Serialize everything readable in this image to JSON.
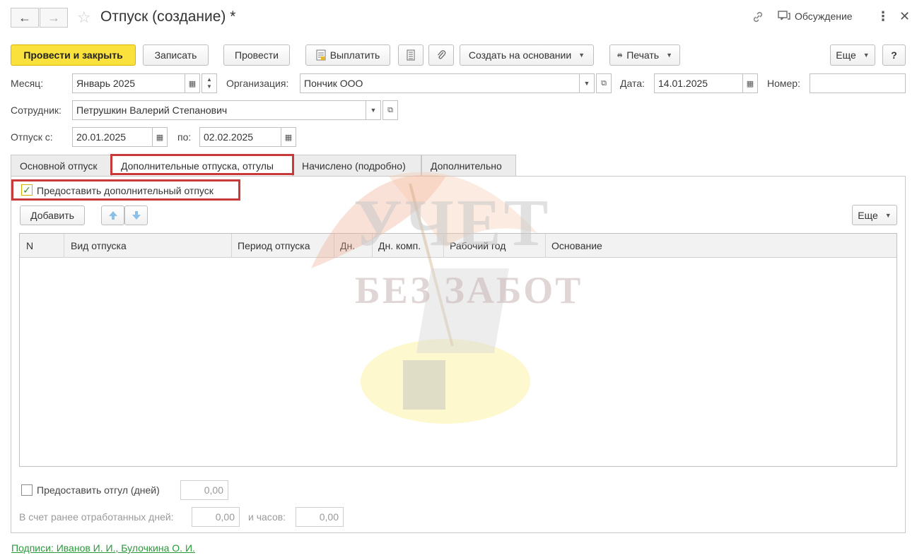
{
  "window": {
    "title": "Отпуск (создание) *",
    "discussion_label": "Обсуждение"
  },
  "toolbar": {
    "post_close": "Провести и закрыть",
    "save": "Записать",
    "post": "Провести",
    "pay": "Выплатить",
    "create_based": "Создать на основании",
    "print": "Печать",
    "more": "Еще",
    "help": "?"
  },
  "form": {
    "month_label": "Месяц:",
    "month_value": "Январь 2025",
    "org_label": "Организация:",
    "org_value": "Пончик ООО",
    "date_label": "Дата:",
    "date_value": "14.01.2025",
    "number_label": "Номер:",
    "number_value": "",
    "employee_label": "Сотрудник:",
    "employee_value": "Петрушкин Валерий Степанович",
    "vacation_from_label": "Отпуск с:",
    "vacation_from_value": "20.01.2025",
    "vacation_to_label": "по:",
    "vacation_to_value": "02.02.2025"
  },
  "tabs": [
    {
      "label": "Основной отпуск",
      "active": false
    },
    {
      "label": "Дополнительные отпуска, отгулы",
      "active": true
    },
    {
      "label": "Начислено (подробно)",
      "active": false
    },
    {
      "label": "Дополнительно",
      "active": false
    }
  ],
  "panel": {
    "grant_additional_label": "Предоставить дополнительный отпуск",
    "grant_additional_checked": true,
    "add_button": "Добавить",
    "more_button": "Еще",
    "columns": [
      "N",
      "Вид отпуска",
      "Период отпуска",
      "Дн.",
      "Дн. комп.",
      "Рабочий год",
      "Основание"
    ],
    "rows": [],
    "time_off_label": "Предоставить отгул (дней)",
    "time_off_checked": false,
    "time_off_days": "0,00",
    "worked_days_label": "В счет ранее отработанных дней:",
    "worked_days_value": "0,00",
    "hours_label": "и часов:",
    "hours_value": "0,00"
  },
  "footer": {
    "signatures_link": "Подписи: Иванов И. И., Булочкина О. И."
  },
  "watermark": {
    "line1": "УЧЕТ",
    "line2": "БЕЗ ЗАБОТ"
  },
  "colors": {
    "primary_button": "#fbe13c",
    "highlight_border": "#c8393a",
    "link": "#2a9a3a",
    "check": "#3a8d2e"
  }
}
